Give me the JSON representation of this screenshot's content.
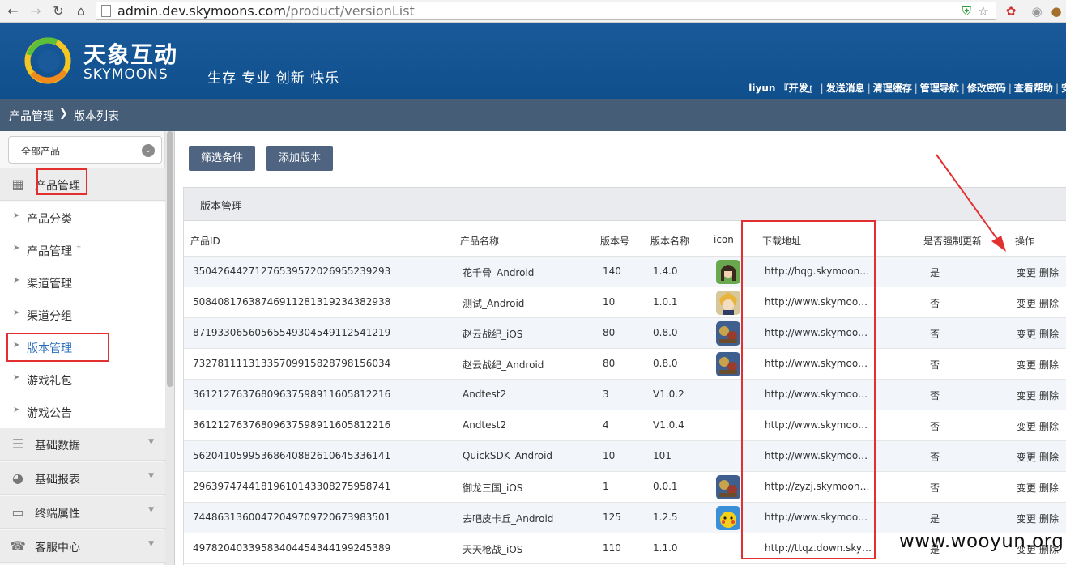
{
  "browser": {
    "url_host": "admin.dev.skymoons.com",
    "url_path": "/product/versionList"
  },
  "header": {
    "brand_cn": "天象互动",
    "brand_en": "SKYMOONS",
    "slogan": "生存 专业 创新 快乐",
    "user": "liyun",
    "role": "『开发』",
    "links": [
      "发送消息",
      "清理缓存",
      "管理导航",
      "修改密码",
      "查看帮助",
      "安"
    ]
  },
  "breadcrumb": {
    "level1": "产品管理",
    "level2": "版本列表"
  },
  "sidebar": {
    "select_value": "全部产品",
    "section_product": "产品管理",
    "items": [
      "产品分类",
      "产品管理",
      "渠道管理",
      "渠道分组",
      "版本管理",
      "游戏礼包",
      "游戏公告"
    ],
    "collapsed_sections": [
      "基础数据",
      "基础报表",
      "终端属性",
      "客服中心"
    ]
  },
  "toolbar": {
    "filter": "筛选条件",
    "add": "添加版本"
  },
  "panel_title": "版本管理",
  "columns": [
    "产品ID",
    "产品名称",
    "版本号",
    "版本名称",
    "icon",
    "下载地址",
    "是否强制更新",
    "操作"
  ],
  "rows": [
    {
      "id": "35042644271276539572026955239293",
      "name": "花千骨_Android",
      "ver": "140",
      "vname": "1.4.0",
      "icon": "girl",
      "url": "http://hqg.skymoons.com/",
      "force": "是"
    },
    {
      "id": "50840817638746911281319234382938",
      "name": "测试_Android",
      "ver": "10",
      "vname": "1.0.1",
      "icon": "anime",
      "url": "http://www.skymoons.com/",
      "force": "否"
    },
    {
      "id": "87193306560565549304549112541219",
      "name": "赵云战纪_iOS",
      "ver": "80",
      "vname": "0.8.0",
      "icon": "battle",
      "url": "http://www.skymoons.com/",
      "force": "否"
    },
    {
      "id": "73278111131335709915828798156034",
      "name": "赵云战纪_Android",
      "ver": "80",
      "vname": "0.8.0",
      "icon": "battle",
      "url": "http://www.skymoons.com/",
      "force": "否"
    },
    {
      "id": "36121276376809637598911605812216",
      "name": "Andtest2",
      "ver": "3",
      "vname": "V1.0.2",
      "icon": "",
      "url": "http://www.skymoons.com/",
      "force": "否"
    },
    {
      "id": "36121276376809637598911605812216",
      "name": "Andtest2",
      "ver": "4",
      "vname": "V1.0.4",
      "icon": "",
      "url": "http://www.skymoons.com/",
      "force": "否"
    },
    {
      "id": "56204105995368640882610645336141",
      "name": "QuickSDK_Android",
      "ver": "10",
      "vname": "101",
      "icon": "",
      "url": "http://www.skymoons.com/",
      "force": "否"
    },
    {
      "id": "29639747441819610143308275958741",
      "name": "御龙三国_iOS",
      "ver": "1",
      "vname": "0.0.1",
      "icon": "battle",
      "url": "http://zyzj.skymoons.com/",
      "force": "否"
    },
    {
      "id": "74486313600472049709720673983501",
      "name": "去吧皮卡丘_Android",
      "ver": "125",
      "vname": "1.2.5",
      "icon": "pika",
      "url": "http://www.skymoons.com/",
      "force": "是"
    },
    {
      "id": "49782040339583404454344199245389",
      "name": "天天枪战_iOS",
      "ver": "110",
      "vname": "1.1.0",
      "icon": "",
      "url": "http://ttqz.down.skymoons.com/",
      "force": "是"
    }
  ],
  "ops": {
    "edit": "变更",
    "delete": "删除"
  },
  "watermark": "www.wooyun.org",
  "colors": {
    "header_blue": "#14558f",
    "crumb": "#465d78",
    "button": "#4f6480",
    "annotation_red": "#e23030"
  }
}
